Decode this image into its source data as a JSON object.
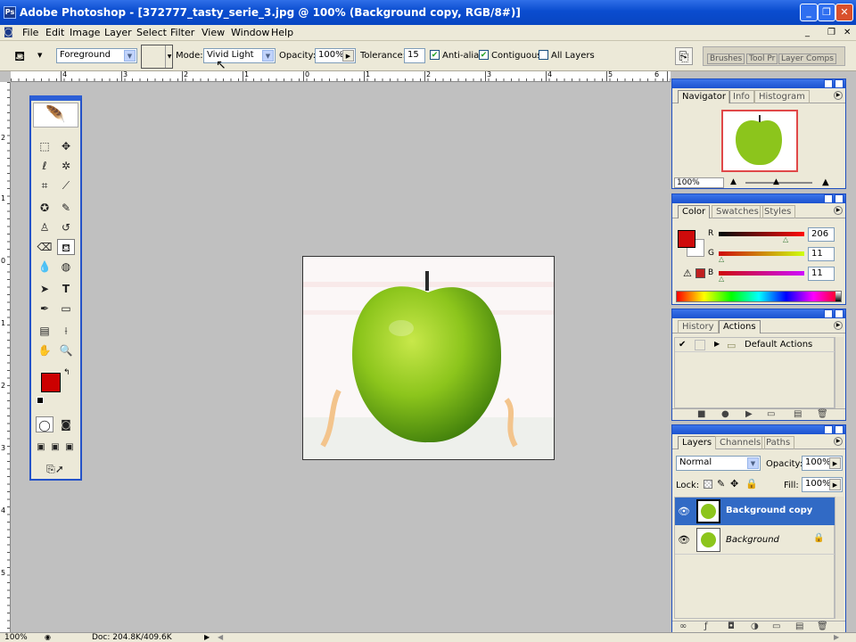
{
  "window": {
    "title": "Adobe Photoshop - [372777_tasty_serie_3.jpg @ 100% (Background copy, RGB/8#)]",
    "controls": [
      "_",
      "❐",
      "✕"
    ],
    "doc_controls": [
      "_",
      "❐",
      "✕"
    ]
  },
  "menu": [
    "File",
    "Edit",
    "Image",
    "Layer",
    "Select",
    "Filter",
    "View",
    "Window",
    "Help"
  ],
  "options": {
    "fill_source": "Foreground",
    "mode_label": "Mode:",
    "mode_value": "Vivid Light",
    "opacity_label": "Opacity:",
    "opacity_value": "100%",
    "tolerance_label": "Tolerance:",
    "tolerance_value": "15",
    "anti_alias": "Anti-alias",
    "contiguous": "Contiguous",
    "all_layers": "All Layers",
    "palette_tabs": [
      "Brushes",
      "Tool Pr",
      "Layer Comps"
    ]
  },
  "rulers": {
    "top": [
      "4",
      "3",
      "2",
      "1",
      "0",
      "1",
      "2",
      "3",
      "4",
      "5",
      "6"
    ],
    "left": [
      "2",
      "1",
      "0",
      "1",
      "2",
      "3",
      "4",
      "5"
    ]
  },
  "navigator": {
    "tabs": [
      "Navigator",
      "Info",
      "Histogram"
    ],
    "zoom": "100%"
  },
  "color_panel": {
    "tabs": [
      "Color",
      "Swatches",
      "Styles"
    ],
    "r_label": "R",
    "g_label": "G",
    "b_label": "B",
    "r": "206",
    "g": "11",
    "b": "11",
    "foreground": "#ce0b0b"
  },
  "actions_panel": {
    "tabs": [
      "History",
      "Actions"
    ],
    "item": "Default Actions"
  },
  "layers_panel": {
    "tabs": [
      "Layers",
      "Channels",
      "Paths"
    ],
    "blend_mode": "Normal",
    "opacity_label": "Opacity:",
    "opacity": "100%",
    "lock_label": "Lock:",
    "fill_label": "Fill:",
    "fill": "100%",
    "layers": [
      {
        "name": "Background copy",
        "selected": true
      },
      {
        "name": "Background",
        "selected": false
      }
    ]
  },
  "status": {
    "zoom": "100%",
    "doc": "Doc: 204.8K/409.6K"
  },
  "colors": {
    "accent": "#2452c8",
    "selection": "#316ac5",
    "foreground_swatch": "#cc0000"
  }
}
